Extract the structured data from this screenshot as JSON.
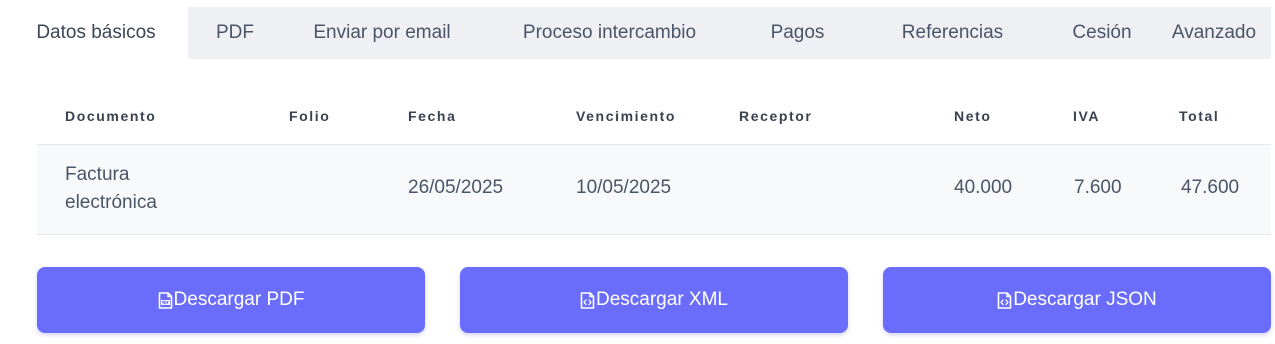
{
  "tabs": [
    {
      "label": "Datos básicos",
      "active": true
    },
    {
      "label": "PDF"
    },
    {
      "label": "Enviar por email"
    },
    {
      "label": "Proceso intercambio"
    },
    {
      "label": "Pagos"
    },
    {
      "label": "Referencias"
    },
    {
      "label": "Cesión"
    },
    {
      "label": "Avanzado"
    }
  ],
  "table": {
    "headers": {
      "documento": "Documento",
      "folio": "Folio",
      "fecha": "Fecha",
      "vencimiento": "Vencimiento",
      "receptor": "Receptor",
      "neto": "Neto",
      "iva": "IVA",
      "total": "Total"
    },
    "rows": [
      {
        "documento": "Factura electrónica",
        "folio": "",
        "fecha": "26/05/2025",
        "vencimiento": "10/05/2025",
        "receptor": "",
        "neto": "40.000",
        "iva": "7.600",
        "total": "47.600"
      }
    ]
  },
  "buttons": {
    "pdf": {
      "label": "Descargar PDF",
      "icon": "file-pdf-icon"
    },
    "xml": {
      "label": "Descargar XML",
      "icon": "file-code-icon"
    },
    "json": {
      "label": "Descargar JSON",
      "icon": "file-code-icon"
    }
  },
  "colors": {
    "accent": "#6a6dfb",
    "tabbar_bg": "#eef0f4",
    "row_bg": "#f8f9fb"
  }
}
